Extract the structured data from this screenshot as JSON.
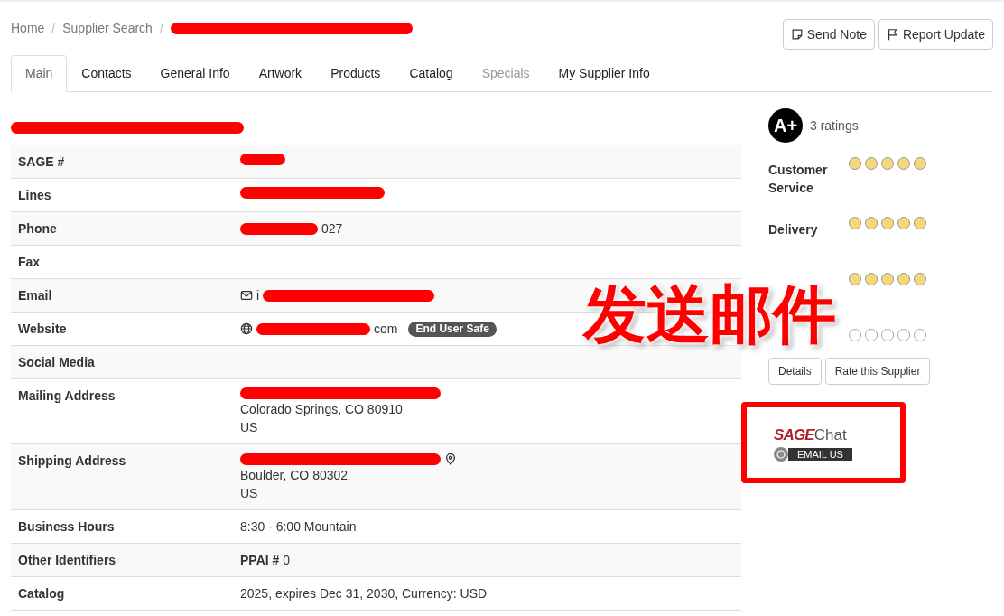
{
  "breadcrumb": [
    {
      "label": "Home",
      "separator": "/"
    },
    {
      "label": "Supplier Search",
      "separator": "/"
    }
  ],
  "actions": [
    {
      "label": "Send Note"
    },
    {
      "label": "Report Update"
    }
  ],
  "tabs": [
    {
      "label": "Main",
      "selected": true,
      "disabled": false
    },
    {
      "label": "Contacts",
      "selected": false,
      "disabled": false
    },
    {
      "label": "General Info",
      "selected": false,
      "disabled": false
    },
    {
      "label": "Artwork",
      "selected": false,
      "disabled": false
    },
    {
      "label": "Products",
      "selected": false,
      "disabled": false
    },
    {
      "label": "Catalog",
      "selected": false,
      "disabled": false
    },
    {
      "label": "Specials",
      "selected": false,
      "disabled": true
    },
    {
      "label": "My Supplier Info",
      "selected": false,
      "disabled": false
    }
  ],
  "details": [
    {
      "label": "SAGE #",
      "lines": [
        [
          {
            "kind": "redaction"
          }
        ]
      ]
    },
    {
      "label": "Lines",
      "lines": [
        [
          {
            "kind": "redaction"
          }
        ]
      ]
    },
    {
      "label": "Phone",
      "lines": [
        [
          {
            "kind": "redaction"
          },
          {
            "kind": "text",
            "text": "027"
          }
        ]
      ]
    },
    {
      "label": "Fax"
    },
    {
      "label": "Email",
      "lines": [
        [
          {
            "kind": "mail"
          },
          {
            "kind": "text",
            "text": "i"
          },
          {
            "kind": "redaction"
          }
        ]
      ]
    },
    {
      "label": "Website",
      "lines": [
        [
          {
            "kind": "globe"
          },
          {
            "kind": "redaction"
          },
          {
            "kind": "text",
            "text": "com"
          },
          {
            "kind": "badge",
            "text": "End User Safe"
          }
        ]
      ]
    },
    {
      "label": "Social Media"
    },
    {
      "label": "Mailing Address",
      "lines": [
        [
          {
            "kind": "redaction"
          }
        ],
        [
          {
            "kind": "text",
            "text": "Colorado Springs, CO 80910"
          }
        ],
        [
          {
            "kind": "text",
            "text": "US"
          }
        ]
      ]
    },
    {
      "label": "Shipping Address",
      "lines": [
        [
          {
            "kind": "redaction"
          },
          {
            "kind": "pin"
          }
        ],
        [
          {
            "kind": "text",
            "text": "Boulder, CO 80302"
          }
        ],
        [
          {
            "kind": "text",
            "text": "US"
          }
        ]
      ]
    },
    {
      "label": "Business Hours",
      "lines": [
        [
          {
            "kind": "text",
            "text": "8:30 - 6:00 Mountain"
          }
        ]
      ]
    },
    {
      "label": "Other Identifiers",
      "lines": [
        [
          {
            "kind": "bold",
            "text": "PPAI #"
          },
          {
            "kind": "text",
            "text": "0"
          }
        ]
      ]
    },
    {
      "label": "Catalog",
      "lines": [
        [
          {
            "kind": "text",
            "text": "2025, expires Dec 31, 2030, Currency: USD"
          }
        ]
      ]
    }
  ],
  "rating": {
    "grade": "A+",
    "count": "3 ratings",
    "rows": [
      {
        "label": "Customer Service",
        "stars": 5
      },
      {
        "label": "Delivery",
        "stars": 5
      },
      {
        "stars": 5
      },
      {
        "stars": 0
      }
    ],
    "buttons": [
      "Details",
      "Rate this Supplier"
    ]
  },
  "chat": {
    "brand": "SAGE",
    "product": "Chat",
    "action": "EMAIL US"
  },
  "annotation": {
    "text": "发送邮件"
  }
}
